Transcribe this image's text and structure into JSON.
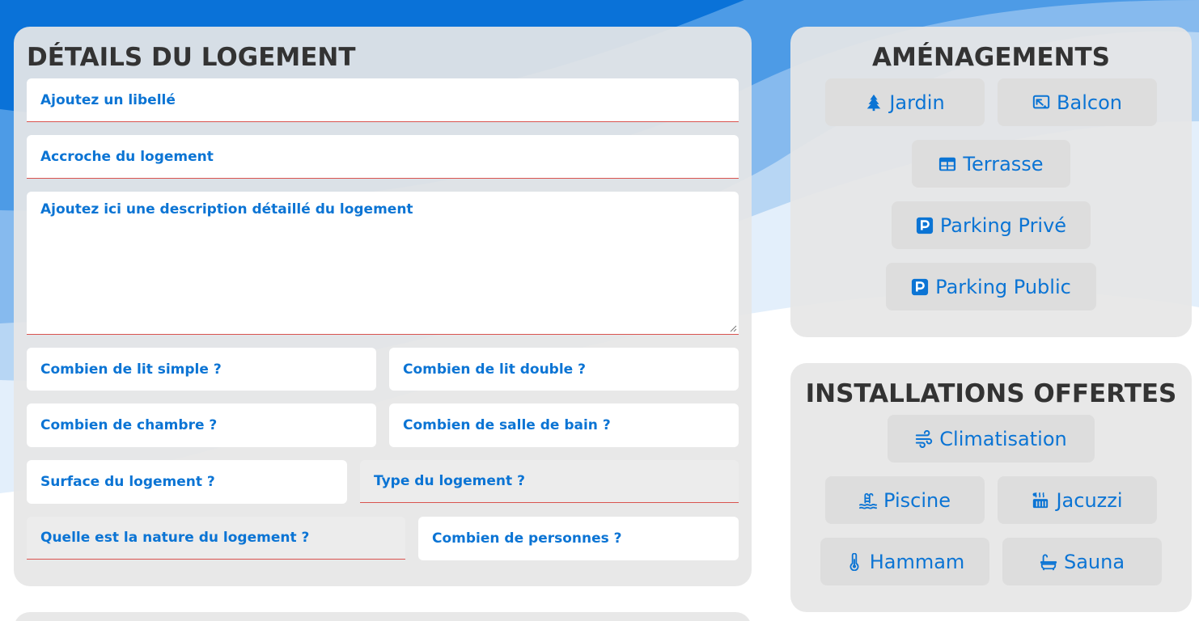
{
  "details": {
    "title": "DÉTAILS DU LOGEMENT",
    "label_placeholder": "Ajoutez un libellé",
    "hook_placeholder": "Accroche du logement",
    "description_placeholder": "Ajoutez ici une description détaillé du logement",
    "single_beds_placeholder": "Combien de lit simple ?",
    "double_beds_placeholder": "Combien de lit double ?",
    "bedrooms_placeholder": "Combien de chambre ?",
    "bathrooms_placeholder": "Combien de salle de bain ?",
    "surface_placeholder": "Surface du logement ?",
    "type_placeholder": "Type du logement ?",
    "nature_placeholder": "Quelle est la nature du logement ?",
    "persons_placeholder": "Combien de personnes ?"
  },
  "amenities": {
    "title": "AMÉNAGEMENTS",
    "items": [
      {
        "label": "Jardin",
        "icon": "tree-icon"
      },
      {
        "label": "Balcon",
        "icon": "balcony-icon"
      },
      {
        "label": "Terrasse",
        "icon": "table-icon"
      },
      {
        "label": "Parking Privé",
        "icon": "parking-icon"
      },
      {
        "label": "Parking Public",
        "icon": "parking-icon"
      }
    ]
  },
  "installations": {
    "title": "INSTALLATIONS OFFERTES",
    "items": [
      {
        "label": "Climatisation",
        "icon": "wind-icon"
      },
      {
        "label": "Piscine",
        "icon": "pool-icon"
      },
      {
        "label": "Jacuzzi",
        "icon": "hot-tub-icon"
      },
      {
        "label": "Hammam",
        "icon": "thermometer-icon"
      },
      {
        "label": "Sauna",
        "icon": "bath-icon"
      }
    ]
  },
  "colors": {
    "accent": "#0b74d4",
    "title": "#333333",
    "panel": "#e6e6e6",
    "chip": "#dddddd",
    "underline": "#d9534f"
  }
}
